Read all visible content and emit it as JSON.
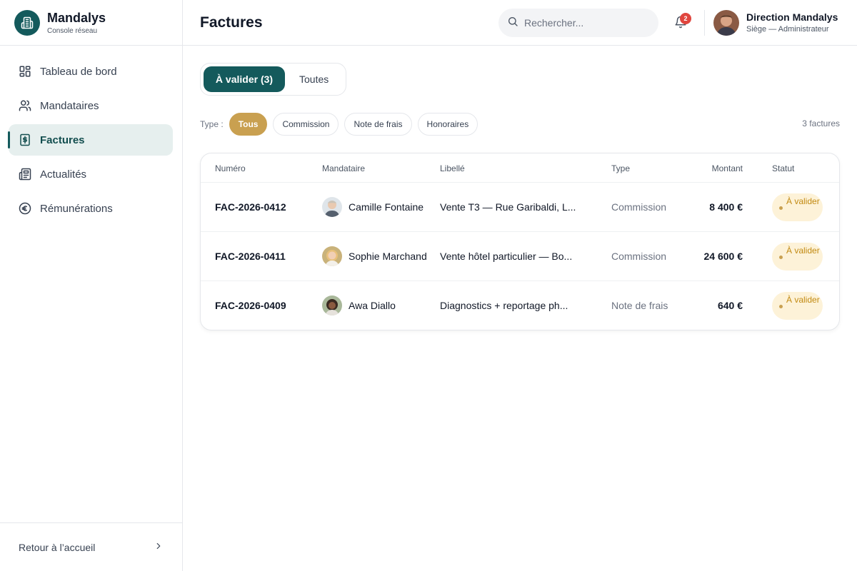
{
  "brand": {
    "name": "Mandalys",
    "subtitle": "Console réseau"
  },
  "sidebar": {
    "items": [
      {
        "label": "Tableau de bord",
        "icon": "dashboard-icon"
      },
      {
        "label": "Mandataires",
        "icon": "users-icon"
      },
      {
        "label": "Factures",
        "icon": "invoice-icon",
        "active": true
      },
      {
        "label": "Actualités",
        "icon": "newspaper-icon"
      },
      {
        "label": "Rémunérations",
        "icon": "euro-icon"
      }
    ],
    "footer_label": "Retour à l’accueil"
  },
  "header": {
    "title": "Factures",
    "search_placeholder": "Rechercher...",
    "notification_count": "2",
    "user_name": "Direction Mandalys",
    "user_role": "Siège — Administrateur"
  },
  "tabs": [
    {
      "label": "À valider (3)",
      "active": true
    },
    {
      "label": "Toutes",
      "active": false
    }
  ],
  "filters": {
    "label": "Type :",
    "chips": [
      {
        "label": "Tous",
        "active": true
      },
      {
        "label": "Commission",
        "active": false
      },
      {
        "label": "Note de frais",
        "active": false
      },
      {
        "label": "Honoraires",
        "active": false
      }
    ],
    "count": "3 factures"
  },
  "table": {
    "columns": [
      "Numéro",
      "Mandataire",
      "Libellé",
      "Type",
      "Montant",
      "Statut"
    ],
    "rows": [
      {
        "numero": "FAC-2026-0412",
        "mandataire": "Camille Fontaine",
        "libelle": "Vente T3 — Rue Garibaldi, L...",
        "type": "Commission",
        "montant": "8 400 €",
        "statut": "À valider"
      },
      {
        "numero": "FAC-2026-0411",
        "mandataire": "Sophie Marchand",
        "libelle": "Vente hôtel particulier — Bo...",
        "type": "Commission",
        "montant": "24 600 €",
        "statut": "À valider"
      },
      {
        "numero": "FAC-2026-0409",
        "mandataire": "Awa Diallo",
        "libelle": "Diagnostics + reportage ph...",
        "type": "Note de frais",
        "montant": "640 €",
        "statut": "À valider"
      }
    ]
  },
  "colors": {
    "primary": "#145a5c",
    "accent": "#c9a050",
    "status_bg": "#fdf2d8",
    "status_text": "#c28a12",
    "badge": "#e0463e"
  }
}
